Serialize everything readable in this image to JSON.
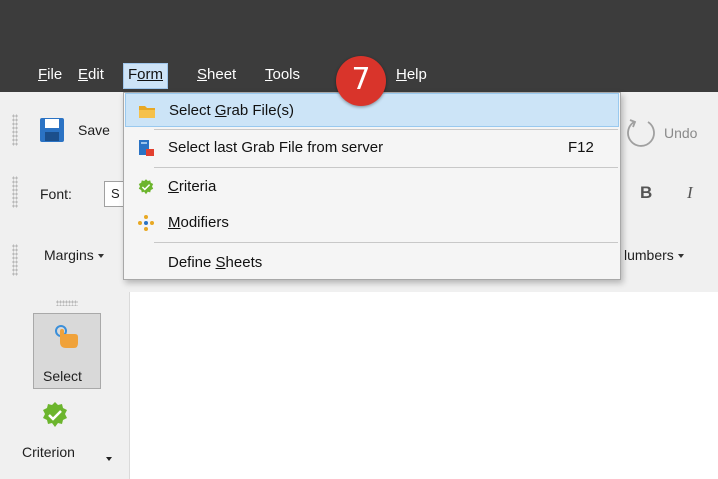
{
  "menubar": {
    "items": [
      {
        "key": "F",
        "rest": "ile"
      },
      {
        "key": "E",
        "rest": "dit"
      },
      {
        "key": "F",
        "rest": "orm"
      },
      {
        "key": "S",
        "rest": "heet"
      },
      {
        "key": "T",
        "rest": "ools"
      },
      {
        "key": "H",
        "rest": "elp"
      }
    ]
  },
  "step_badge": "7",
  "form_menu": {
    "items": [
      {
        "pre": "Select ",
        "key": "G",
        "post": "rab File(s)",
        "shortcut": ""
      },
      {
        "pre": "Select last Grab File from server",
        "key": "",
        "post": "",
        "shortcut": "F12"
      },
      {
        "pre": "",
        "key": "C",
        "post": "riteria",
        "shortcut": ""
      },
      {
        "pre": "",
        "key": "M",
        "post": "odifiers",
        "shortcut": ""
      },
      {
        "pre": "Define ",
        "key": "S",
        "post": "heets",
        "shortcut": ""
      }
    ]
  },
  "toolbar": {
    "save_label": "Save",
    "undo_label": "Undo",
    "font_label": "Font:",
    "font_value": "S",
    "bold_label": "B",
    "italic_label": "I",
    "margins_label": "Margins",
    "numbers_label": "lumbers"
  },
  "tools": {
    "select_label": "Select",
    "criterion_label": "Criterion"
  },
  "colors": {
    "menubar_bg": "#3c3c3c",
    "highlight": "#cce4f7",
    "badge": "#d9342b",
    "criteria_green": "#6cb52d"
  }
}
